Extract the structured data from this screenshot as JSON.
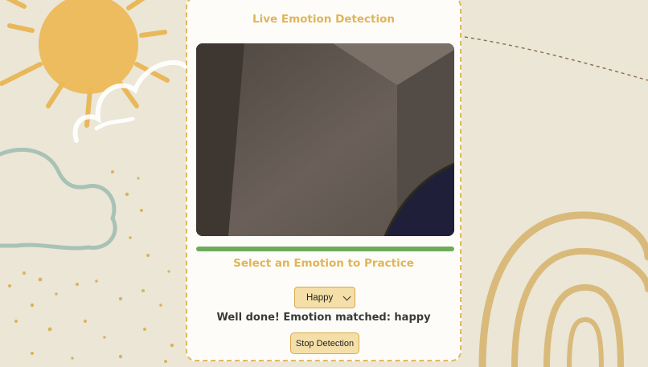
{
  "app": {
    "title": "Live Emotion Detection"
  },
  "video": {
    "progress": 1.0
  },
  "practice": {
    "heading": "Select an Emotion to Practice",
    "selected_emotion": "Happy",
    "status_message": "Well done! Emotion matched: happy",
    "stop_button_label": "Stop Detection"
  },
  "colors": {
    "accent": "#e0b558",
    "progress_fill": "#6bab5a",
    "button_bg": "#f4dfa8",
    "page_bg": "#ebe6d6"
  },
  "icons": {
    "select_indicator": "chevron-down-icon"
  }
}
